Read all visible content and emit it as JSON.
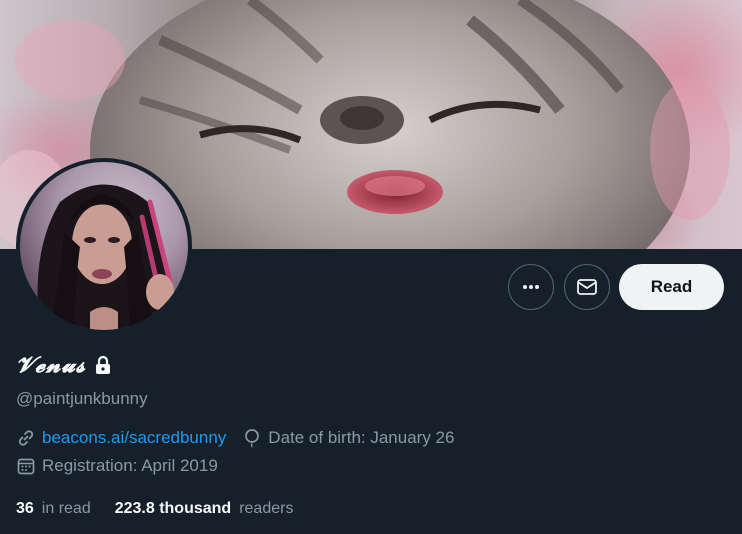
{
  "profile": {
    "display_name": "𝓥𝓮𝓷𝓾𝓼",
    "handle": "@paintjunkbunny",
    "website": "beacons.ai/sacredbunny",
    "birthday": "Date of birth: January 26",
    "joined": "Registration: April 2019"
  },
  "actions": {
    "more_icon": "ellipsis-icon",
    "message_icon": "envelope-icon",
    "read_label": "Read"
  },
  "stats": {
    "following_count": "36",
    "following_label": "in read",
    "followers_count": "223.8 thousand",
    "followers_label": "readers"
  },
  "icons": {
    "lock": "lock-icon",
    "link": "link-icon",
    "birthday": "balloon-icon",
    "calendar": "calendar-icon"
  },
  "colors": {
    "background": "#15202b",
    "link": "#1d9bf0",
    "secondary_text": "#8b98a5",
    "button_bg": "#eff3f4"
  }
}
